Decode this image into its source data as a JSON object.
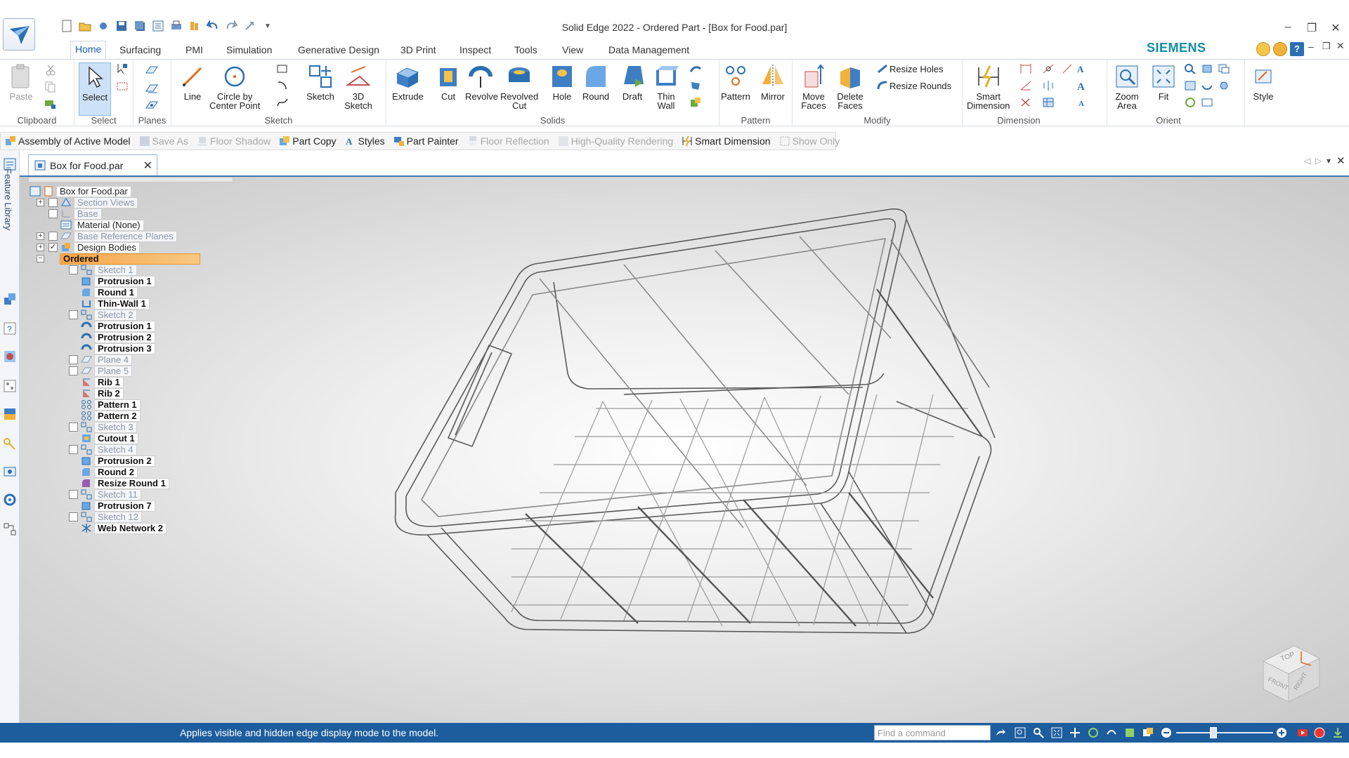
{
  "window": {
    "title": "Solid Edge 2022 - Ordered Part - [Box for Food.par]",
    "brand": "SIEMENS"
  },
  "ribbon_tabs": [
    "Home",
    "Surfacing",
    "PMI",
    "Simulation",
    "Generative Design",
    "3D Print",
    "Inspect",
    "Tools",
    "View",
    "Data Management"
  ],
  "ribbon": {
    "clipboard": {
      "label": "Clipboard",
      "paste": "Paste"
    },
    "select": {
      "label": "Select",
      "select": "Select"
    },
    "planes": {
      "label": "Planes"
    },
    "sketch": {
      "label": "Sketch",
      "line": "Line",
      "circle": "Circle by\nCenter Point",
      "sketch": "Sketch",
      "sketch3d": "3D\nSketch"
    },
    "solids": {
      "label": "Solids",
      "extrude": "Extrude",
      "cut": "Cut",
      "revolve": "Revolve",
      "revolved_cut": "Revolved\nCut",
      "hole": "Hole",
      "round": "Round",
      "draft": "Draft",
      "thin_wall": "Thin\nWall"
    },
    "pattern": {
      "label": "Pattern",
      "pattern": "Pattern",
      "mirror": "Mirror"
    },
    "modify": {
      "label": "Modify",
      "move_faces": "Move\nFaces",
      "delete_faces": "Delete\nFaces",
      "resize_holes": "Resize Holes",
      "resize_rounds": "Resize Rounds"
    },
    "dimension": {
      "label": "Dimension",
      "smart_dimension": "Smart\nDimension"
    },
    "orient": {
      "label": "Orient",
      "zoom_area": "Zoom\nArea",
      "fit": "Fit"
    },
    "style": {
      "style": "Style"
    }
  },
  "command_bar": [
    {
      "label": "Assembly of Active Model",
      "enabled": true
    },
    {
      "label": "Save As",
      "enabled": false
    },
    {
      "label": "Floor Shadow",
      "enabled": false
    },
    {
      "label": "Part Copy",
      "enabled": true
    },
    {
      "label": "Styles",
      "enabled": true
    },
    {
      "label": "Part Painter",
      "enabled": true
    },
    {
      "label": "Floor Reflection",
      "enabled": false
    },
    {
      "label": "High-Quality Rendering",
      "enabled": false
    },
    {
      "label": "Smart Dimension",
      "enabled": true
    },
    {
      "label": "Show Only",
      "enabled": false
    }
  ],
  "document_tab": "Box for Food.par",
  "side_panel": {
    "feature_library": "Feature Library"
  },
  "tree": [
    {
      "label": "Box for Food.par",
      "style": "root"
    },
    {
      "label": "Section Views",
      "style": "dim"
    },
    {
      "label": "Base",
      "style": "dim"
    },
    {
      "label": "Material (None)",
      "style": "normal"
    },
    {
      "label": "Base Reference Planes",
      "style": "dim"
    },
    {
      "label": "Design Bodies",
      "style": "normal"
    },
    {
      "label": "Ordered",
      "style": "ordered"
    },
    {
      "label": "Sketch 1",
      "style": "dim"
    },
    {
      "label": "Protrusion 1",
      "style": "bold"
    },
    {
      "label": "Round 1",
      "style": "bold"
    },
    {
      "label": "Thin-Wall 1",
      "style": "bold"
    },
    {
      "label": "Sketch 2",
      "style": "dim"
    },
    {
      "label": "Protrusion 1",
      "style": "bold"
    },
    {
      "label": "Protrusion 2",
      "style": "bold"
    },
    {
      "label": "Protrusion 3",
      "style": "bold"
    },
    {
      "label": "Plane 4",
      "style": "dim"
    },
    {
      "label": "Plane 5",
      "style": "dim"
    },
    {
      "label": "Rib 1",
      "style": "bold"
    },
    {
      "label": "Rib 2",
      "style": "bold"
    },
    {
      "label": "Pattern 1",
      "style": "bold"
    },
    {
      "label": "Pattern 2",
      "style": "bold"
    },
    {
      "label": "Sketch 3",
      "style": "dim"
    },
    {
      "label": "Cutout 1",
      "style": "bold"
    },
    {
      "label": "Sketch 4",
      "style": "dim"
    },
    {
      "label": "Protrusion 2",
      "style": "bold"
    },
    {
      "label": "Round 2",
      "style": "bold"
    },
    {
      "label": "Resize Round 1",
      "style": "bold"
    },
    {
      "label": "Sketch 11",
      "style": "dim"
    },
    {
      "label": "Protrusion 7",
      "style": "bold"
    },
    {
      "label": "Sketch 12",
      "style": "dim"
    },
    {
      "label": "Web Network 2",
      "style": "bold"
    }
  ],
  "viewcube": {
    "top": "TOP",
    "front": "FRONT",
    "right": "RIGHT"
  },
  "status": {
    "message": "Applies visible and hidden edge display mode to the model.",
    "find_placeholder": "Find a command"
  },
  "colors": {
    "statusbar": "#1d5d9d",
    "ordered_highlight": "#f6a54a",
    "accent": "#1b5fa8",
    "brand": "#0f8fa6"
  }
}
